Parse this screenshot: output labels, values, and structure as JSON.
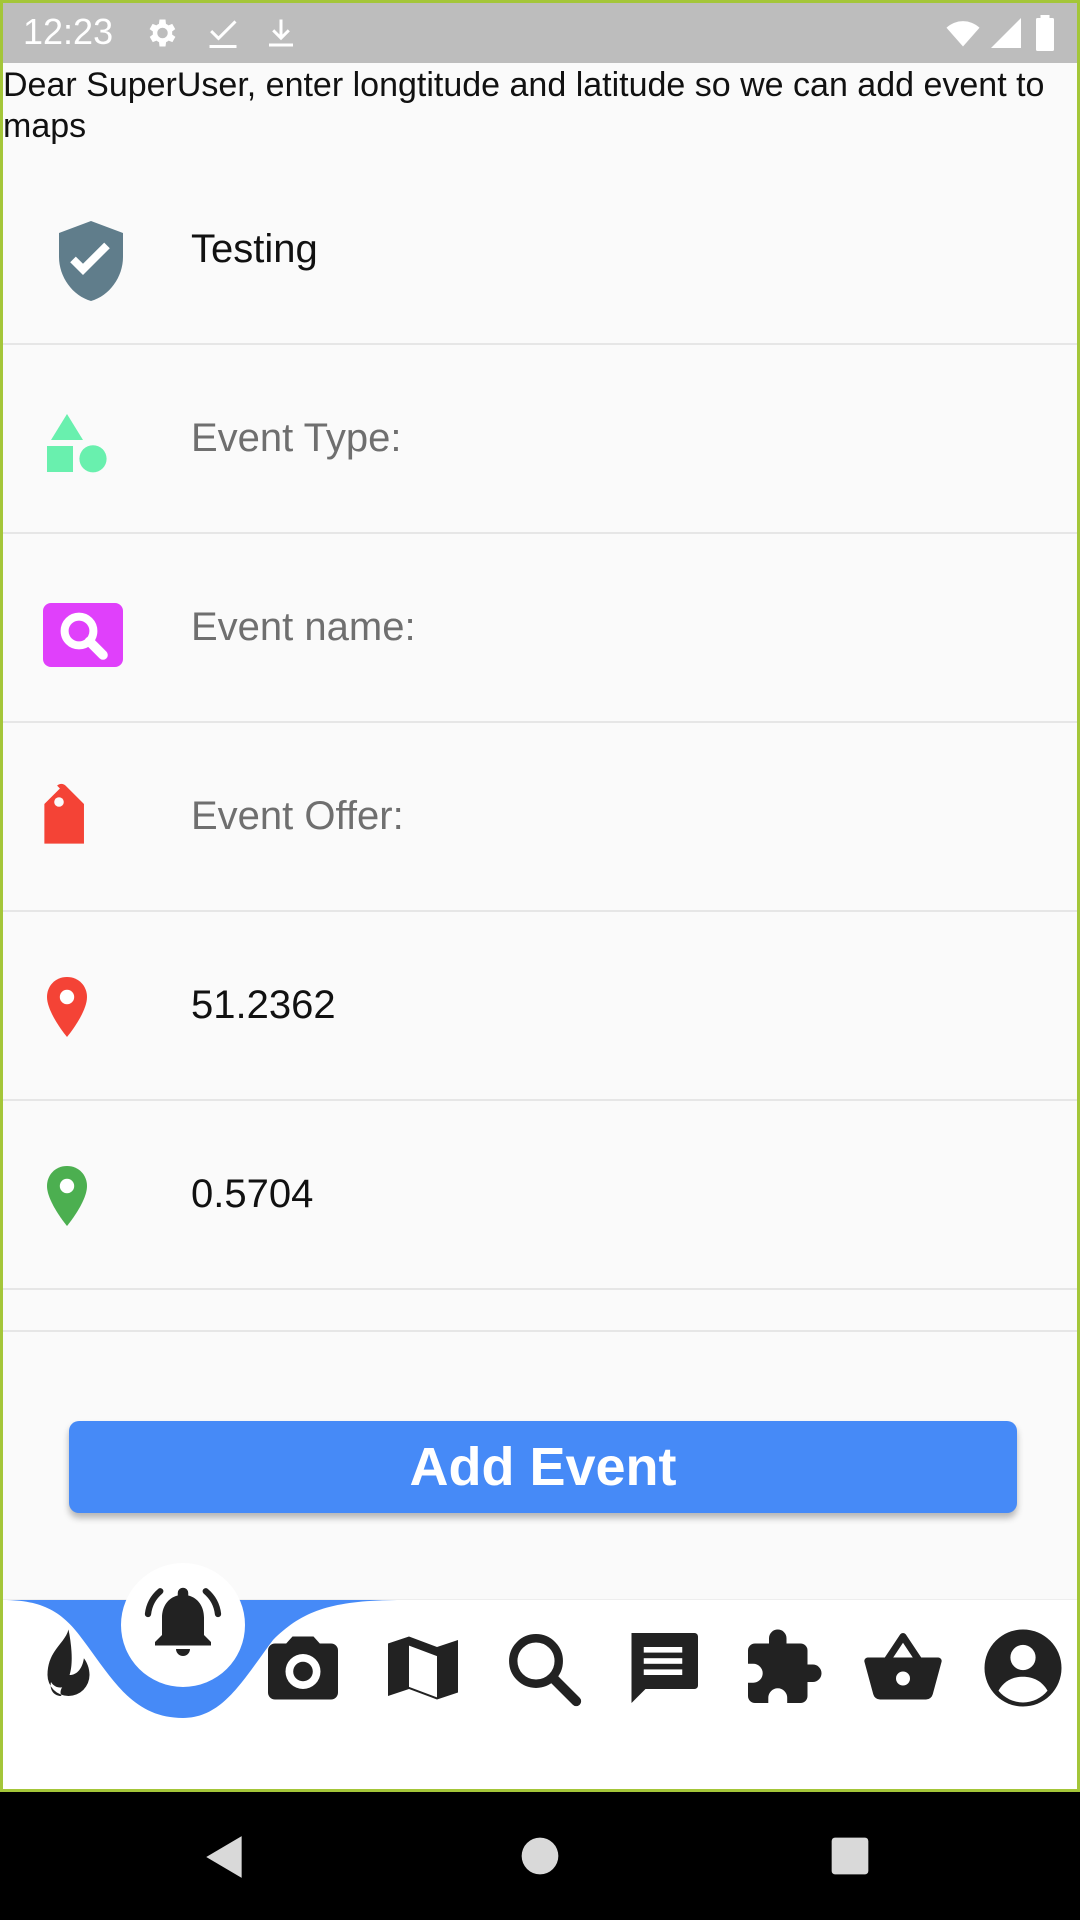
{
  "status_bar": {
    "time": "12:23",
    "left_icons": [
      "settings-icon",
      "check-icon",
      "download-icon"
    ],
    "right_icons": [
      "wifi-icon",
      "signal-icon",
      "battery-icon"
    ]
  },
  "intro_text": "Dear SuperUser, enter longtitude and latitude so we can add event to maps",
  "form": {
    "rows": [
      {
        "icon": "shield-check-icon",
        "icon_color": "#607d8b",
        "text": "Testing",
        "kind": "value"
      },
      {
        "icon": "shapes-icon",
        "icon_color": "#69f0ae",
        "text": "Event Type:",
        "kind": "placeholder"
      },
      {
        "icon": "search-box-icon",
        "icon_color": "#e040fb",
        "text": "Event name:",
        "kind": "placeholder"
      },
      {
        "icon": "tag-icon",
        "icon_color": "#f44336",
        "text": "Event Offer:",
        "kind": "placeholder"
      },
      {
        "icon": "map-pin-icon",
        "icon_color": "#f44336",
        "text": "51.2362",
        "kind": "value"
      },
      {
        "icon": "map-pin-icon",
        "icon_color": "#4caf50",
        "text": "0.5704",
        "kind": "value"
      }
    ]
  },
  "add_button": {
    "label": "Add Event",
    "color": "#468af7"
  },
  "bottom_nav": {
    "accent_color": "#468af7",
    "items": [
      "flame-icon",
      "bell-icon",
      "camera-icon",
      "map-icon",
      "search-icon",
      "chat-icon",
      "puzzle-icon",
      "basket-icon",
      "account-icon"
    ],
    "selected_index": 1
  },
  "system_nav": [
    "back-icon",
    "home-icon",
    "recents-icon"
  ]
}
